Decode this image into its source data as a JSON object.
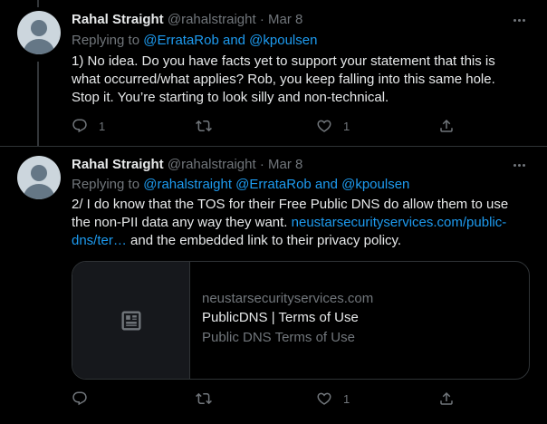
{
  "tweets": [
    {
      "name": "Rahal Straight",
      "handle": "@rahalstraight",
      "sep": "·",
      "date": "Mar 8",
      "replying_prefix": "Replying to",
      "replying_targets": "@ErrataRob and @kpoulsen",
      "text": "1) No idea. Do you have facts yet to support your statement that this is what occurred/what applies? Rob, you keep falling into this same hole. Stop it. You’re starting to look silly and non-technical.",
      "actions": {
        "reply_count": "1",
        "retweet_count": "",
        "like_count": "1"
      }
    },
    {
      "name": "Rahal Straight",
      "handle": "@rahalstraight",
      "sep": "·",
      "date": "Mar 8",
      "replying_prefix": "Replying to",
      "replying_targets": "@rahalstraight @ErrataRob and @kpoulsen",
      "text_before_link": "2/ I do know that the TOS for their Free Public DNS do allow them to use the non-PII data any way they want. ",
      "link_text": "neustarsecurityservices.com/public-dns/ter…",
      "text_after_link": " and the embedded link to their privacy policy.",
      "card": {
        "icon": "article-icon",
        "domain": "neustarsecurityservices.com",
        "title": "PublicDNS | Terms of Use",
        "description": "Public DNS Terms of Use"
      },
      "actions": {
        "reply_count": "",
        "retweet_count": "",
        "like_count": "1"
      }
    }
  ],
  "colors": {
    "background": "#000000",
    "text_primary": "#e7e9ea",
    "text_secondary": "#71767b",
    "link": "#1d9bf0",
    "border": "#2f3336"
  }
}
